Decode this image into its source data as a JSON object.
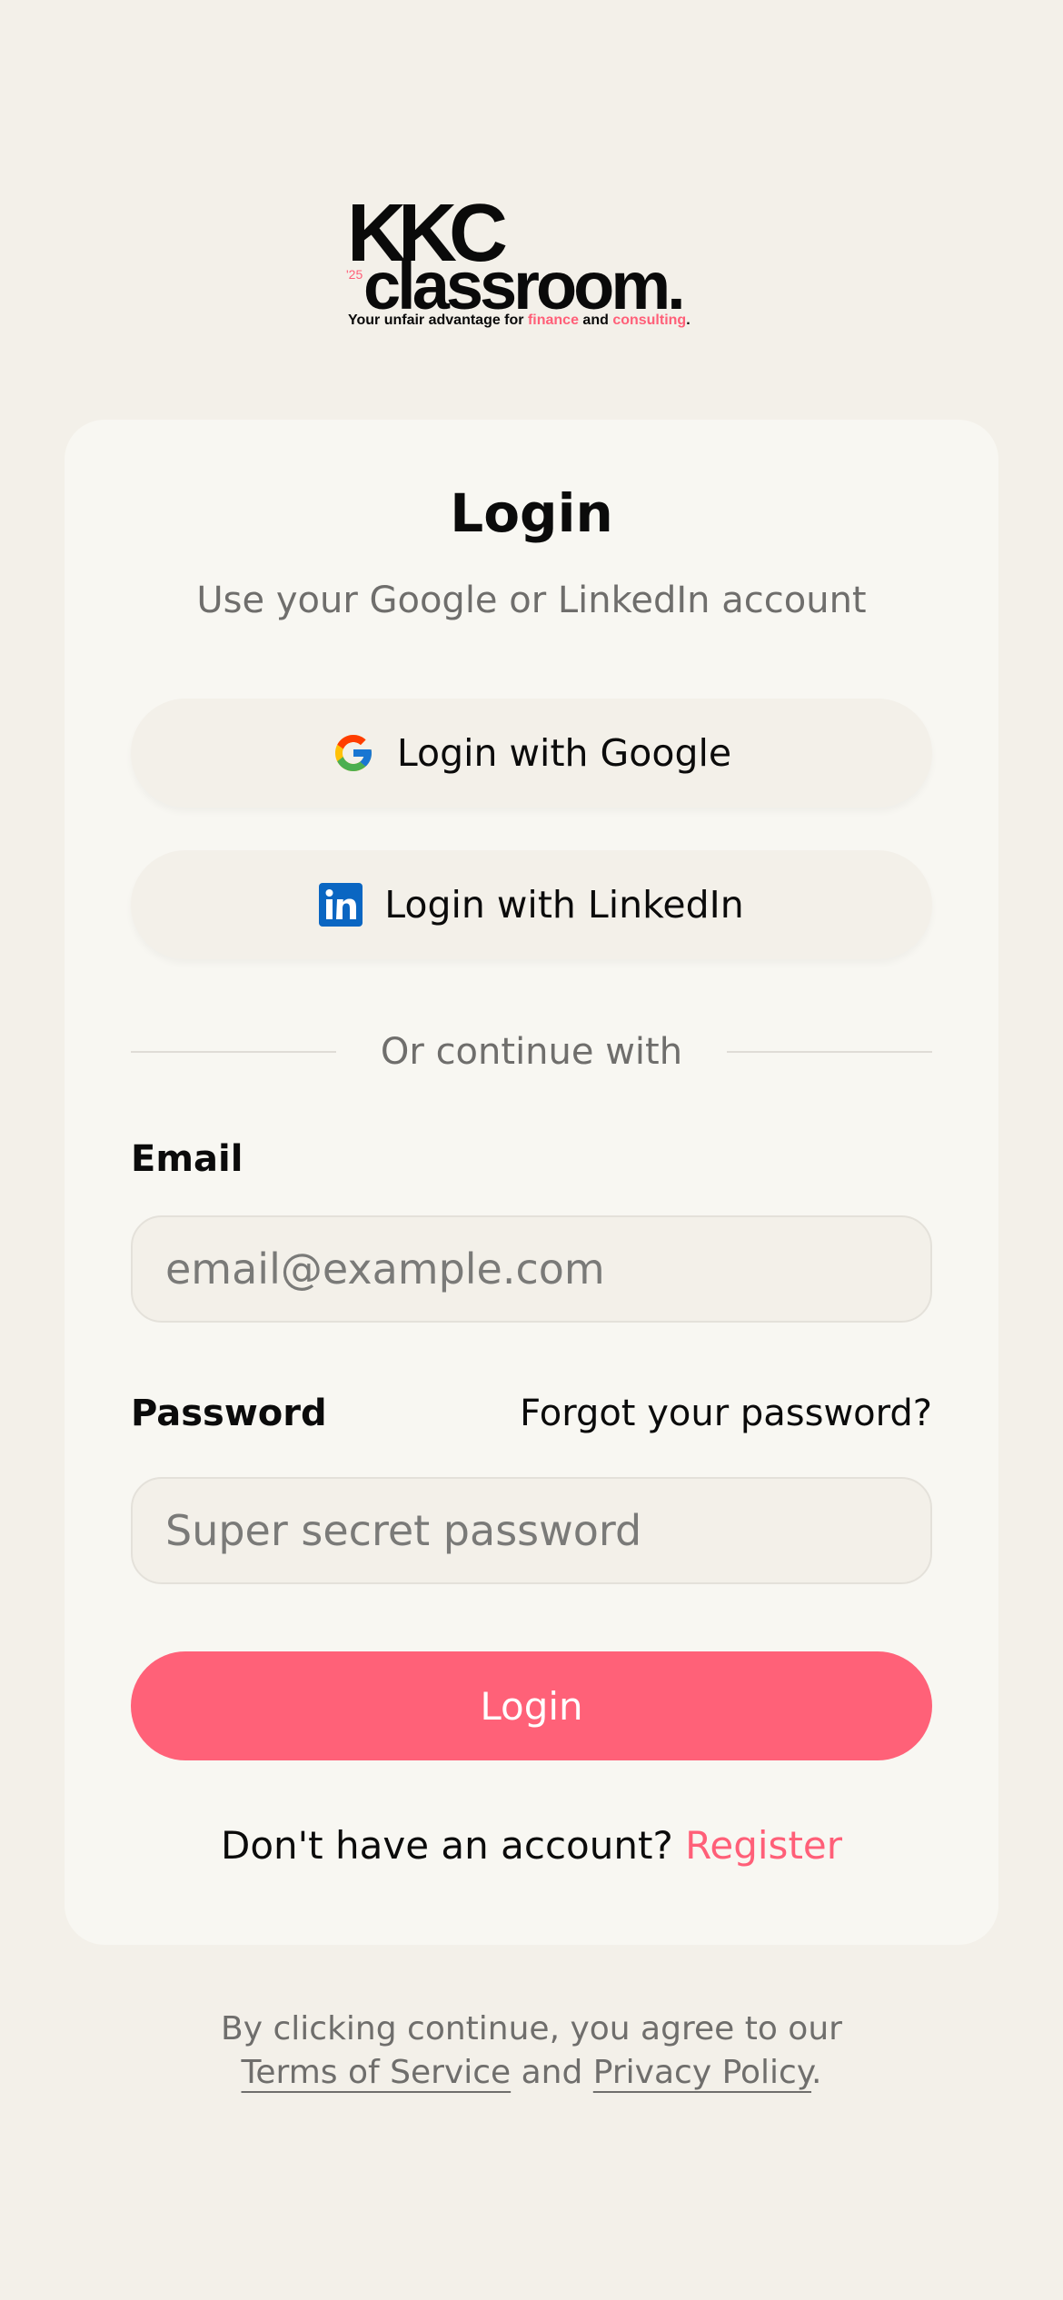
{
  "logo": {
    "kkc": "KKC",
    "year": "'25",
    "classroom": "classroom.",
    "tagline_1": "Your unfair advantage for ",
    "tagline_finance": "finance",
    "tagline_2": " and ",
    "tagline_consulting": "consulting",
    "tagline_3": ".",
    "accent_color": "#ff5f78"
  },
  "card": {
    "title": "Login",
    "subtitle": "Use your Google or LinkedIn account",
    "google_button": {
      "label": "Login with Google",
      "icon": "google-icon"
    },
    "linkedin_button": {
      "label": "Login with LinkedIn",
      "icon": "linkedin-icon"
    },
    "divider_text": "Or continue with",
    "email": {
      "label": "Email",
      "placeholder": "email@example.com"
    },
    "password": {
      "label": "Password",
      "placeholder": "Super secret password",
      "forgot_label": "Forgot your password?"
    },
    "login_button": {
      "label": "Login",
      "color": "#ff6178"
    },
    "register": {
      "prompt": "Don't have an account? ",
      "link_label": "Register"
    }
  },
  "footer": {
    "text_1": "By clicking continue, you agree to our",
    "terms_label": "Terms of Service",
    "and": " and ",
    "privacy_label": "Privacy Policy",
    "period": "."
  }
}
